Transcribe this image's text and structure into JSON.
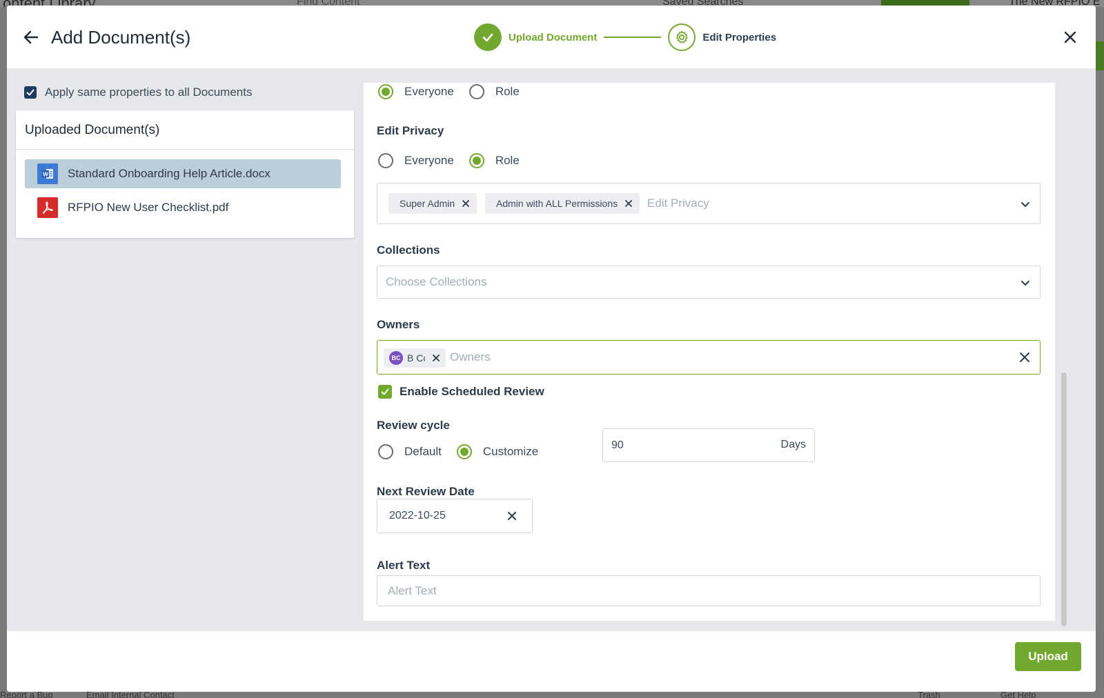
{
  "background": {
    "title": "ontent Library",
    "search_placeholder": "Find Content",
    "saved_searches": "Saved Searches",
    "new_feature": "The New RFPIO E",
    "footer_links": [
      "Report a Bug",
      "Email Internal Contact",
      "Trash",
      "Get Help"
    ]
  },
  "modal": {
    "title": "Add Document(s)",
    "steps": [
      {
        "label": "Upload Document",
        "state": "done"
      },
      {
        "label": "Edit Properties",
        "state": "current"
      }
    ],
    "apply_same_label": "Apply same properties to all Documents",
    "uploaded_title": "Uploaded Document(s)",
    "documents": [
      {
        "name": "Standard Onboarding Help Article.docx",
        "icon": "word-doc-icon",
        "selected": true
      },
      {
        "name": "RFPIO New User Checklist.pdf",
        "icon": "pdf-icon",
        "selected": false
      }
    ],
    "view_privacy": {
      "options": [
        "Everyone",
        "Role"
      ],
      "selected": "Everyone"
    },
    "edit_privacy": {
      "label": "Edit Privacy",
      "options": [
        "Everyone",
        "Role"
      ],
      "selected": "Role",
      "chips": [
        "Super Admin",
        "Admin with ALL Permissions"
      ],
      "placeholder": "Edit Privacy"
    },
    "collections": {
      "label": "Collections",
      "placeholder": "Choose Collections"
    },
    "owners": {
      "label": "Owners",
      "chip_initials": "BC",
      "chip_name": "B Cc",
      "placeholder": "Owners"
    },
    "scheduled_review": {
      "label": "Enable Scheduled Review",
      "checked": true
    },
    "review_cycle": {
      "label": "Review cycle",
      "options": [
        "Default",
        "Customize"
      ],
      "selected": "Customize",
      "days_value": "90",
      "days_unit": "Days"
    },
    "next_review": {
      "label": "Next Review Date",
      "value": "2022-10-25"
    },
    "alert_text": {
      "label": "Alert Text",
      "placeholder": "Alert Text"
    },
    "upload_label": "Upload"
  },
  "colors": {
    "accent": "#73a82e",
    "dark_check": "#1f3a5f",
    "selected_row": "#bcced8",
    "panel_bg": "#e6e8eb"
  }
}
